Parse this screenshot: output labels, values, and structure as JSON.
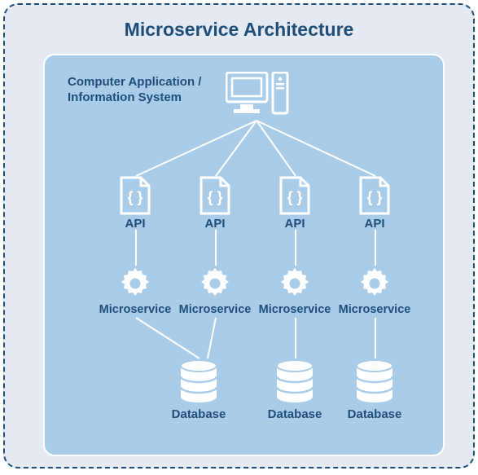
{
  "title": "Microservice Architecture",
  "appLabelLine1": "Computer Application /",
  "appLabelLine2": "Information System",
  "apis": [
    "API",
    "API",
    "API",
    "API"
  ],
  "microservices": [
    "Microservice",
    "Microservice",
    "Microservice",
    "Microservice"
  ],
  "databases": [
    "Database",
    "Database",
    "Database"
  ]
}
